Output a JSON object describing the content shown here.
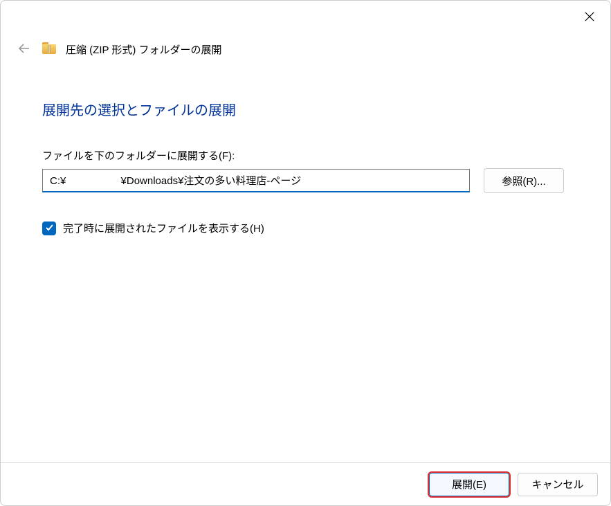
{
  "window": {
    "wizard_title": "圧縮 (ZIP 形式) フォルダーの展開"
  },
  "main": {
    "heading": "展開先の選択とファイルの展開",
    "path_label": "ファイルを下のフォルダーに展開する(F):",
    "path_value": "C:¥                   ¥Downloads¥注文の多い料理店-ページ",
    "browse_label": "参照(R)...",
    "show_files_label": "完了時に展開されたファイルを表示する(H)",
    "show_files_checked": true
  },
  "footer": {
    "extract_label": "展開(E)",
    "cancel_label": "キャンセル"
  }
}
